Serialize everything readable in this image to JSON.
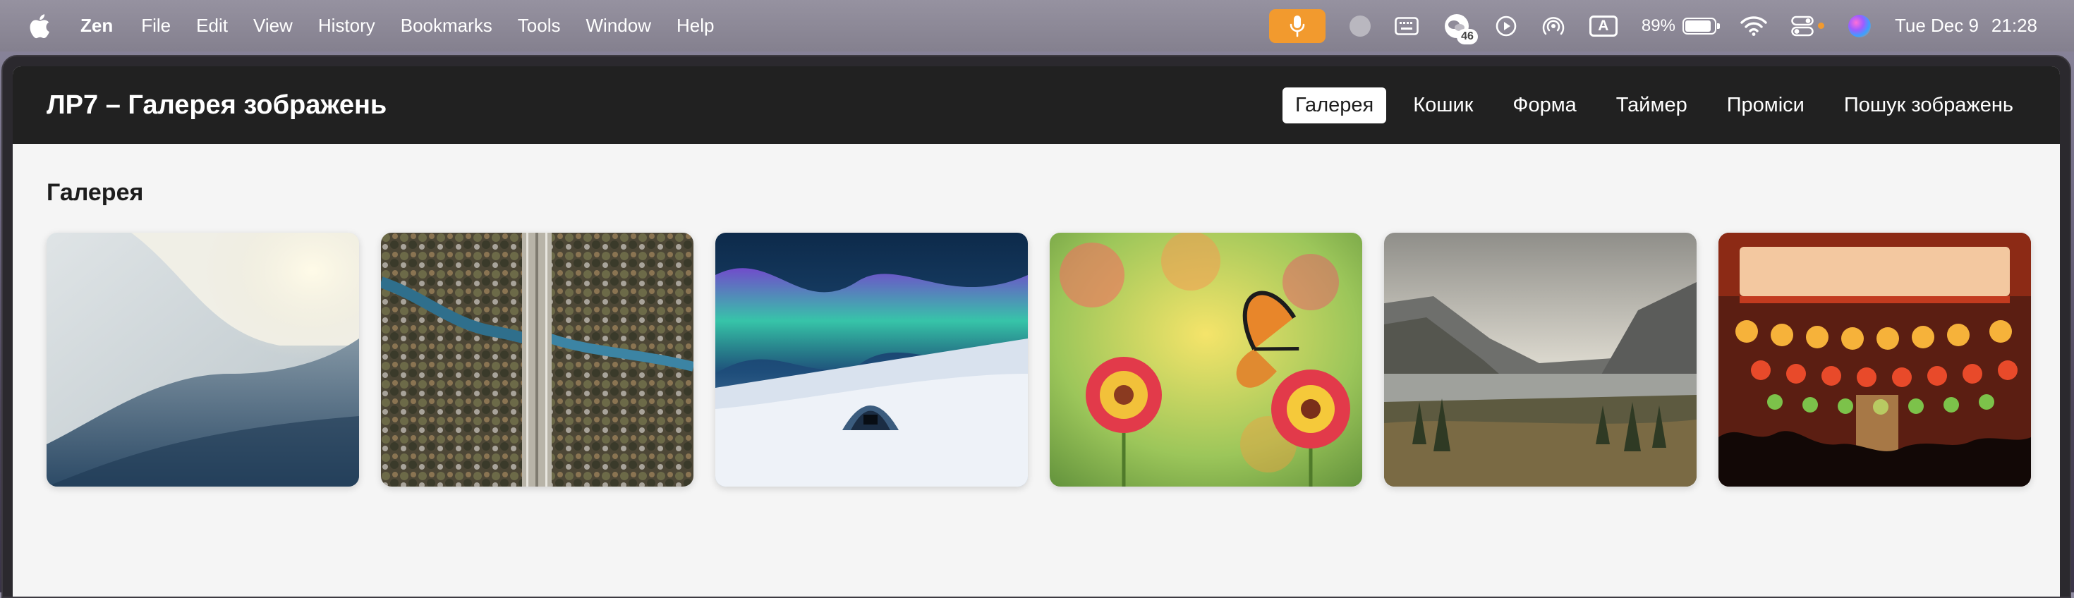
{
  "menubar": {
    "app_name": "Zen",
    "menus": [
      "File",
      "Edit",
      "View",
      "History",
      "Bookmarks",
      "Tools",
      "Window",
      "Help"
    ],
    "badge_count": "46",
    "input_source": "A",
    "battery_percent": "89%",
    "battery_level": 0.89,
    "date": "Tue Dec 9",
    "time": "21:28"
  },
  "app": {
    "title": "ЛР7 – Галерея зображень",
    "nav": [
      "Галерея",
      "Кошик",
      "Форма",
      "Таймер",
      "Проміси",
      "Пошук зображень"
    ],
    "active_nav": "Галерея"
  },
  "gallery": {
    "title": "Галерея",
    "images": [
      {
        "name": "gallery-image-abstract-curve"
      },
      {
        "name": "gallery-image-forest-bridge"
      },
      {
        "name": "gallery-image-aurora-ice"
      },
      {
        "name": "gallery-image-butterfly-flowers"
      },
      {
        "name": "gallery-image-mountain-lake"
      },
      {
        "name": "gallery-image-lantern-street"
      }
    ]
  }
}
